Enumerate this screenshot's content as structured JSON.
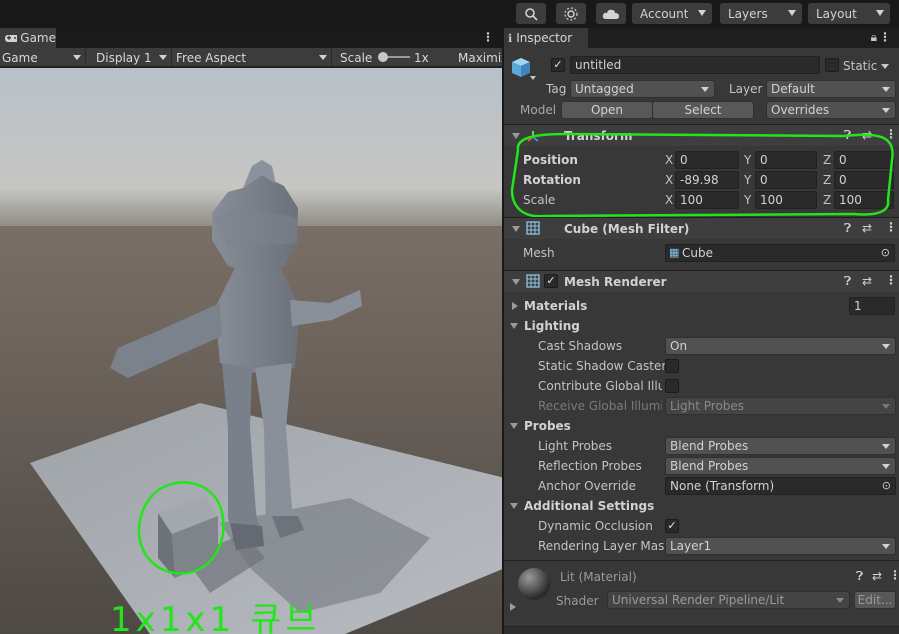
{
  "toolbar": {
    "account_label": "Account",
    "layers_label": "Layers",
    "layout_label": "Layout",
    "icons": [
      "search-icon",
      "services-icon",
      "cloud-icon"
    ]
  },
  "game": {
    "tab_label": "Game",
    "mode_label": "Game",
    "display_label": "Display 1",
    "aspect_label": "Free Aspect",
    "scale_label": "Scale",
    "scale_value": "1x",
    "maximize_label": "Maximiz",
    "annotation_text": "1x1x1 큐브"
  },
  "inspector": {
    "tab_label": "Inspector",
    "object_name": "untitled",
    "static_label": "Static",
    "tag_label": "Tag",
    "tag_value": "Untagged",
    "layer_label": "Layer",
    "layer_value": "Default",
    "model_label": "Model",
    "open_label": "Open",
    "select_label": "Select",
    "overrides_label": "Overrides",
    "transform": {
      "title": "Transform",
      "position_label": "Position",
      "rotation_label": "Rotation",
      "scale_label": "Scale",
      "x_label": "X",
      "y_label": "Y",
      "z_label": "Z",
      "position": {
        "x": "0",
        "y": "0",
        "z": "0"
      },
      "rotation": {
        "x": "-89.98",
        "y": "0",
        "z": "0"
      },
      "scale": {
        "x": "100",
        "y": "100",
        "z": "100"
      }
    },
    "mesh_filter": {
      "title": "Cube (Mesh Filter)",
      "mesh_label": "Mesh",
      "mesh_value": "Cube"
    },
    "mesh_renderer": {
      "title": "Mesh Renderer",
      "materials_label": "Materials",
      "materials_count": "1",
      "lighting_label": "Lighting",
      "cast_shadows_label": "Cast Shadows",
      "cast_shadows_value": "On",
      "static_shadow_caster_label": "Static Shadow Caster",
      "contribute_gi_label": "Contribute Global Illum",
      "receive_gi_label": "Receive Global Illumin",
      "receive_gi_value": "Light Probes",
      "probes_label": "Probes",
      "light_probes_label": "Light Probes",
      "light_probes_value": "Blend Probes",
      "reflection_probes_label": "Reflection Probes",
      "reflection_probes_value": "Blend Probes",
      "anchor_override_label": "Anchor Override",
      "anchor_override_value": "None (Transform)",
      "additional_settings_label": "Additional Settings",
      "dynamic_occlusion_label": "Dynamic Occlusion",
      "rendering_layer_mask_label": "Rendering Layer Mask",
      "rendering_layer_mask_value": "Layer1"
    },
    "material": {
      "title": "Lit (Material)",
      "shader_label": "Shader",
      "shader_value": "Universal Render Pipeline/Lit",
      "edit_label": "Edit..."
    }
  },
  "colors": {
    "annotation_green": "#22e51a",
    "panel_bg": "#383838",
    "field_bg": "#2a2a2a"
  }
}
